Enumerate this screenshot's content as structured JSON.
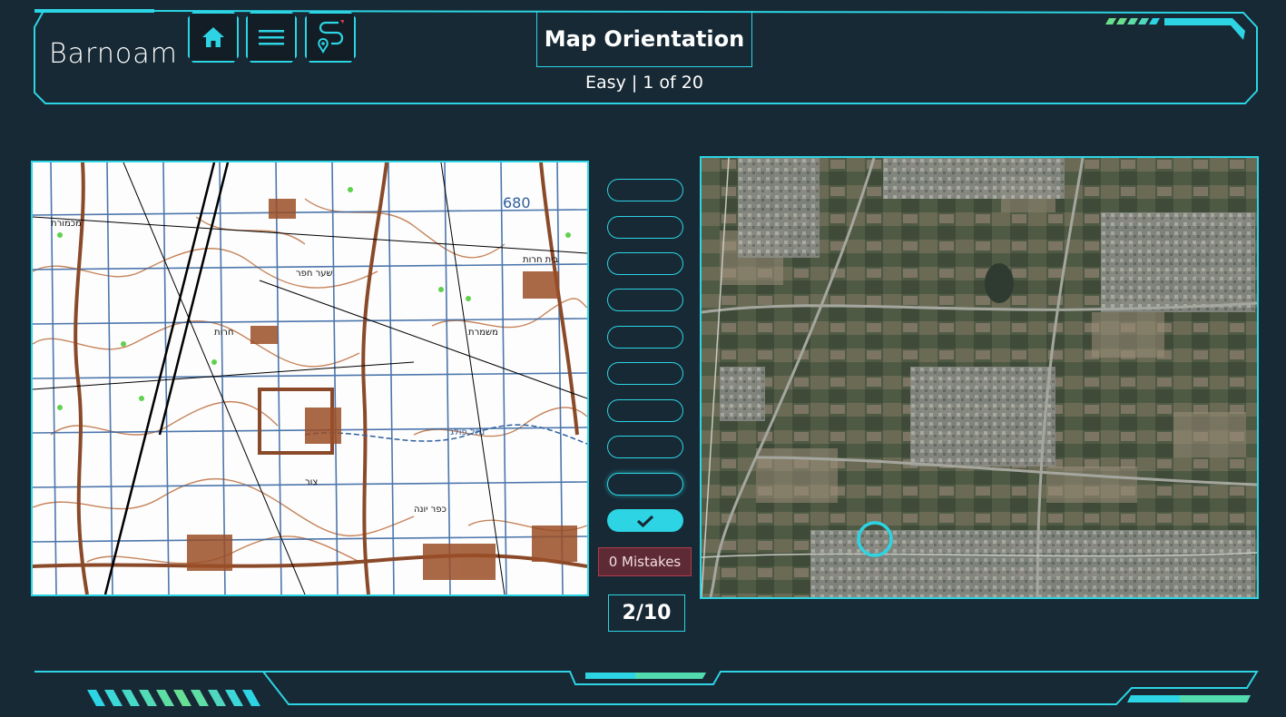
{
  "app": {
    "logo_text": "Barnoam"
  },
  "toolbar": {
    "home_icon": "home-icon",
    "menu_icon": "menu-icon",
    "route_icon": "route-pin-icon"
  },
  "header": {
    "title": "Map Orientation",
    "subtitle": "Easy | 1 of 20"
  },
  "progress": {
    "slots": [
      {
        "state": "empty"
      },
      {
        "state": "empty"
      },
      {
        "state": "empty"
      },
      {
        "state": "empty"
      },
      {
        "state": "empty"
      },
      {
        "state": "empty"
      },
      {
        "state": "empty"
      },
      {
        "state": "empty"
      },
      {
        "state": "current"
      },
      {
        "state": "done"
      }
    ],
    "done_icon": "check-icon"
  },
  "status": {
    "mistakes_label": "0 Mistakes",
    "score": "2/10"
  },
  "map": {
    "height_label": "680",
    "place_labels": [
      "בית חרות",
      "נחל פולג",
      "שער חפר",
      "חרות",
      "מכמורת",
      "משמרת",
      "צור",
      "כפר יונה"
    ]
  },
  "colors": {
    "accent": "#2dd4e3",
    "background": "#172935",
    "mistake_bg": "#5e2a36",
    "contour": "#c0784a",
    "grid": "#2e5f9e"
  }
}
